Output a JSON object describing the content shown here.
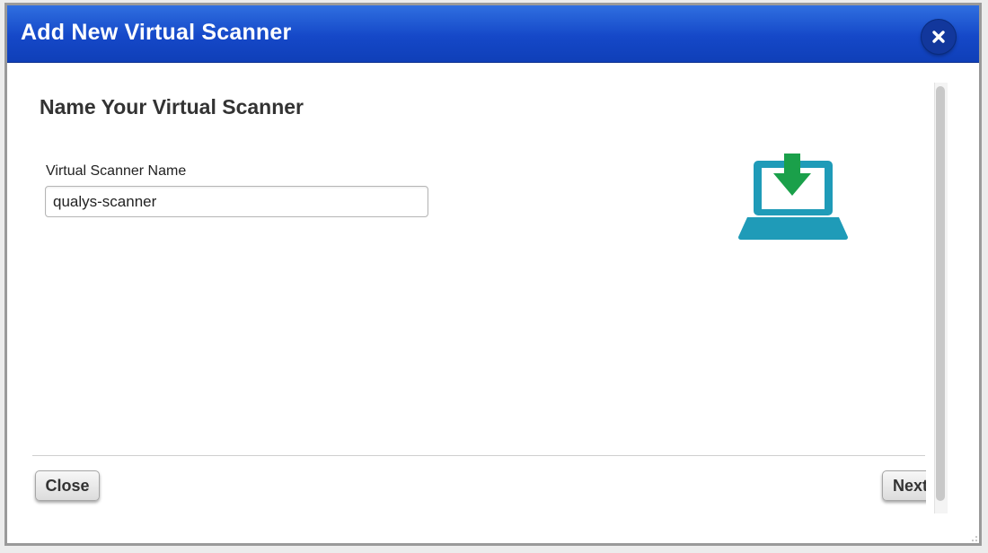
{
  "dialog": {
    "title": "Add New Virtual Scanner",
    "close_icon": "close-icon"
  },
  "step": {
    "heading": "Name Your Virtual Scanner",
    "illustration_icon": "laptop-download-icon"
  },
  "form": {
    "name_label": "Virtual Scanner Name",
    "name_value": "qualys-scanner"
  },
  "footer": {
    "close_label": "Close",
    "next_label": "Next"
  },
  "colors": {
    "title_bar": "#1548c8",
    "laptop": "#1f9bb8",
    "download_arrow": "#1aa04a"
  }
}
